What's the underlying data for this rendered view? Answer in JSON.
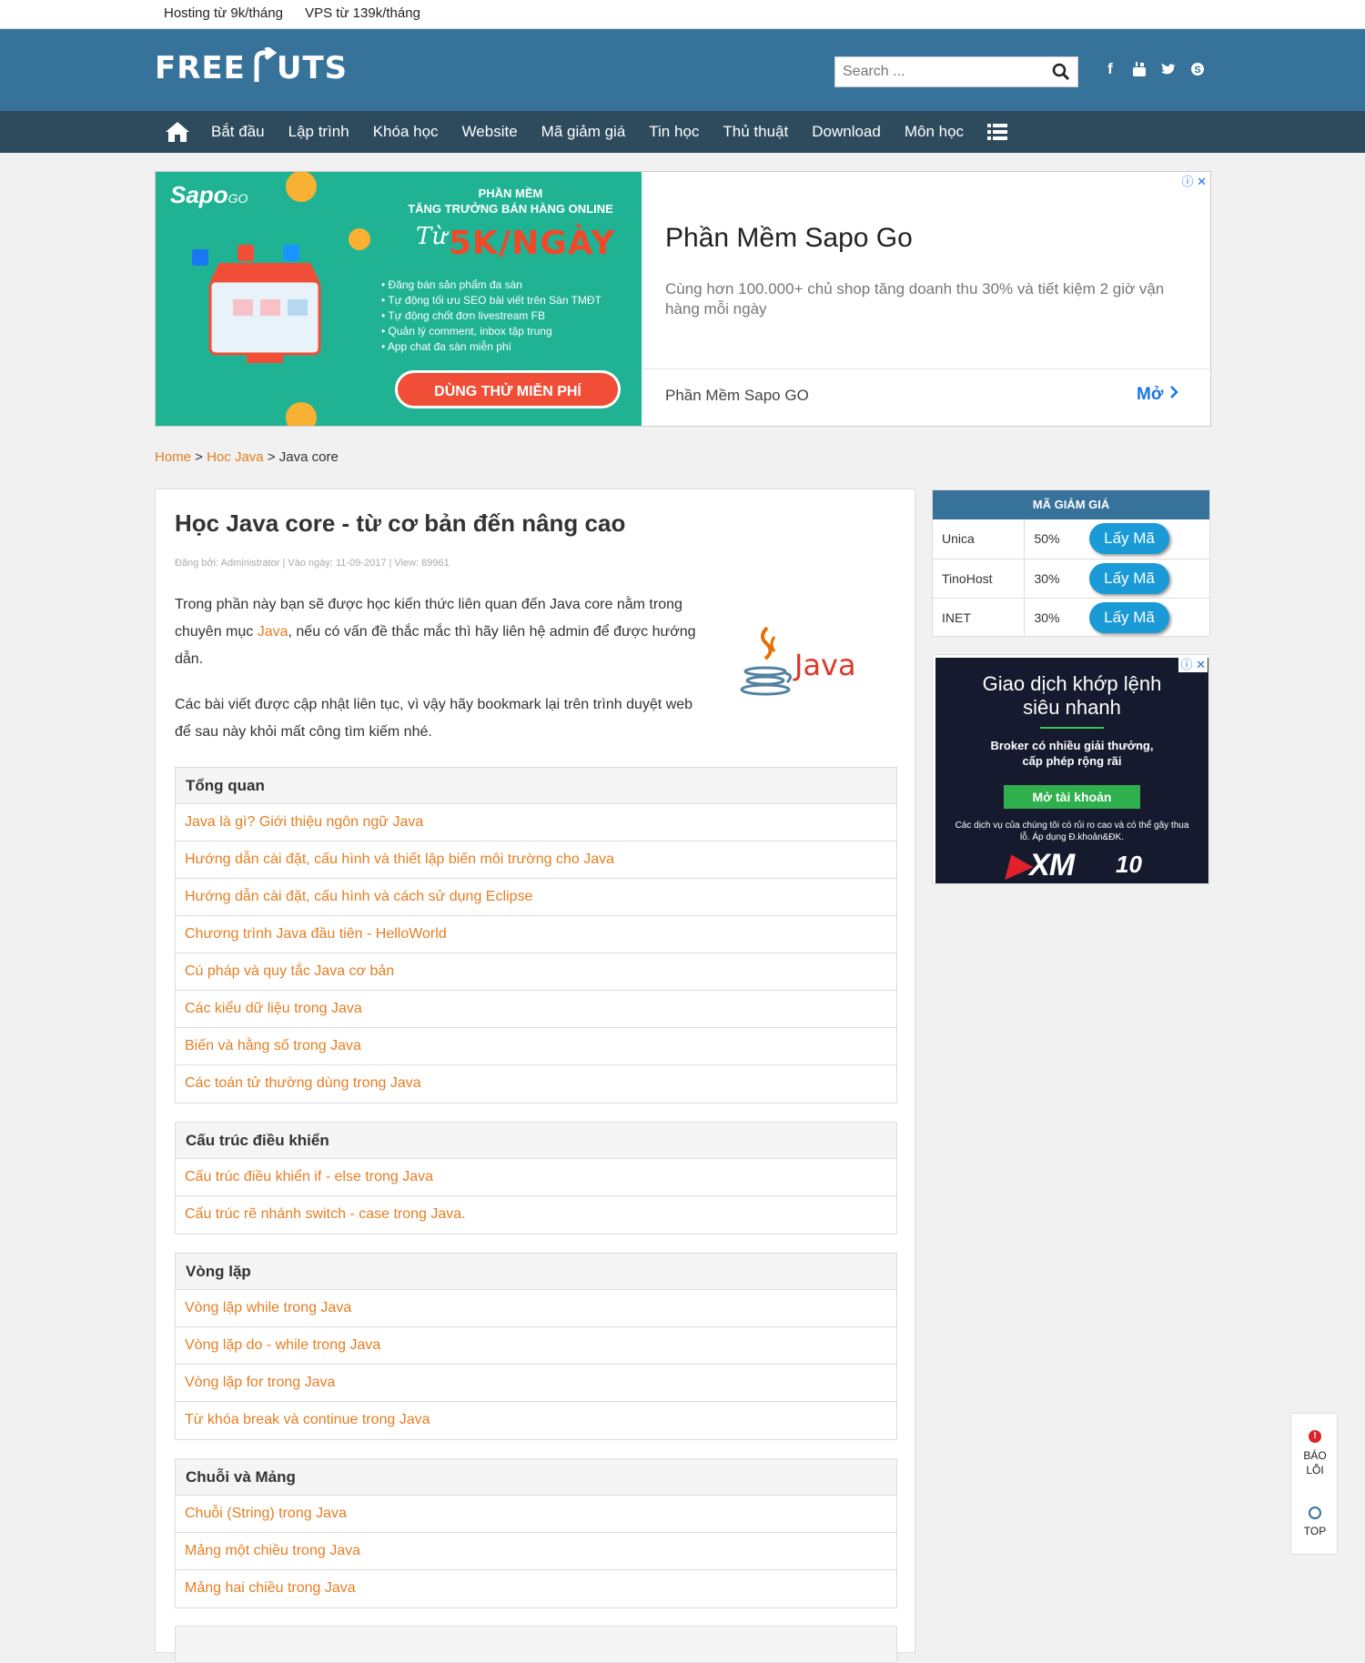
{
  "topbar": {
    "links": [
      "Hosting từ 9k/tháng",
      "VPS từ 139k/tháng"
    ]
  },
  "header": {
    "logo_left": "FREE",
    "logo_right": "UTS",
    "search_placeholder": "Search ...",
    "social_icons": [
      "facebook-icon",
      "youtube-icon",
      "twitter-icon",
      "skype-icon"
    ]
  },
  "nav": {
    "items": [
      "Bắt đầu",
      "Lập trình",
      "Khóa học",
      "Website",
      "Mã giảm giá",
      "Tin học",
      "Thủ thuật",
      "Download",
      "Môn học"
    ]
  },
  "ad_top": {
    "brand": "Sapo",
    "brand_suffix": "GO",
    "kicker_1": "PHẦN MỀM",
    "kicker_2": "TĂNG TRƯỞNG BÁN HÀNG ONLINE",
    "tu": "Từ",
    "headline": "5K/NGÀY",
    "bullets": [
      "• Đăng bán sản phẩm đa sàn",
      "• Tự động tối ưu SEO bài viết trên Sàn TMĐT",
      "• Tự động chốt đơn livestream FB",
      "• Quản lý comment, inbox tập trung",
      "• App chat đa sàn miễn phí"
    ],
    "cta": "DÙNG THỬ MIỄN PHÍ",
    "title": "Phần Mềm Sapo Go",
    "description": "Cùng hơn 100.000+ chủ shop tăng doanh thu 30% và tiết kiệm 2 giờ vận hàng mỗi ngày",
    "footer_text": "Phần Mềm Sapo GO",
    "open_label": "Mở",
    "adchoice": "ⓘ ✕"
  },
  "breadcrumb": {
    "home": "Home",
    "sep": " > ",
    "section": "Hoc Java",
    "current": "Java core"
  },
  "article": {
    "title": "Học Java core - từ cơ bản đến nâng cao",
    "meta": "Đăng bởi: Administrator | Vào ngày: 11-09-2017 | View: 89961",
    "intro_before": "Trong phần này bạn sẽ được học kiến thức liên quan đến Java core nằm trong chuyên mục ",
    "intro_link": "Java",
    "intro_after": ", nếu có vấn đề thắc mắc thì hãy liên hệ admin để được hướng dẫn.",
    "intro2": "Các bài viết được cập nhật liên tục, vì vậy hãy bookmark lại trên trình duyệt web để sau này khỏi mất công tìm kiếm nhé.",
    "java_logo_text": "Java"
  },
  "sections": [
    {
      "title": "Tổng quan",
      "items": [
        "Java là gì? Giới thiệu ngôn ngữ Java",
        "Hướng dẫn cài đặt, cấu hình và thiết lập biến môi trường cho Java",
        "Hướng dẫn cài đặt, cấu hình và cách sử dụng Eclipse",
        "Chương trình Java đầu tiên - HelloWorld",
        "Cú pháp và quy tắc Java cơ bản",
        "Các kiểu dữ liệu trong Java",
        "Biến và hằng số trong Java",
        "Các toán tử thường dùng trong Java"
      ]
    },
    {
      "title": "Cấu trúc điều khiển",
      "items": [
        "Cấu trúc điều khiển if - else trong Java",
        "Cấu trúc rẽ nhánh switch - case trong Java."
      ]
    },
    {
      "title": "Vòng lặp",
      "items": [
        "Vòng lặp while trong Java",
        "Vòng lặp do - while trong Java",
        "Vòng lặp for trong Java",
        "Từ khóa break và continue trong Java"
      ]
    },
    {
      "title": "Chuỗi và Mảng",
      "items": [
        "Chuỗi (String) trong Java",
        "Mảng một chiều trong Java",
        "Mảng hai chiều trong Java"
      ]
    }
  ],
  "coupons": {
    "title": "MÃ GIẢM GIÁ",
    "rows": [
      {
        "name": "Unica",
        "percent": "50%",
        "button": "Lấy Mã"
      },
      {
        "name": "TinoHost",
        "percent": "30%",
        "button": "Lấy Mã"
      },
      {
        "name": "INET",
        "percent": "30%",
        "button": "Lấy Mã"
      }
    ]
  },
  "ad_side": {
    "headline": "Giao dịch khớp lệnh siêu nhanh",
    "sub": "Broker có nhiều giải thưởng, cấp phép rộng rãi",
    "button": "Mở tài khoản",
    "disclaimer": "Các dịch vụ của chúng tôi có rủi ro cao và có thể gây thua lỗ. Áp dụng Đ.khoản&ĐK.",
    "logo": "XM",
    "anniversary": "10",
    "adchoice": "ⓘ ✕"
  },
  "floating": {
    "report_label_1": "BÁO",
    "report_label_2": "LỖI",
    "report_mark": "!",
    "top_label": "TOP"
  },
  "colors": {
    "header": "#36729a",
    "nav": "#2e4a5d",
    "link": "#e67e22",
    "coupon_button": "#1a9ad6",
    "ad_green": "#20b393"
  }
}
